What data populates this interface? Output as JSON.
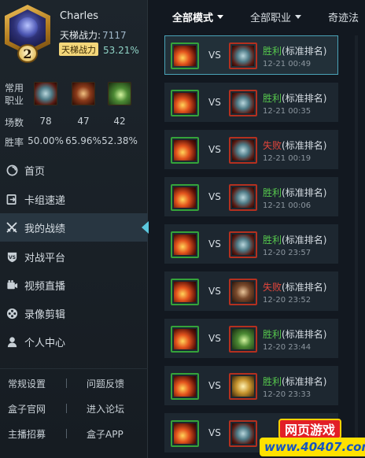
{
  "profile": {
    "name": "Charles",
    "level": "2",
    "rank_power_label": "天梯战力:",
    "rank_power_value": "7117",
    "rank_tag": "天梯战力",
    "rank_pct": "53.21%"
  },
  "stats": {
    "class_label": "常用职业",
    "class_icons": [
      "mech-class-icon",
      "beast-class-icon",
      "nature-class-icon"
    ],
    "games_label": "场数",
    "games": [
      "78",
      "47",
      "42"
    ],
    "winrate_label": "胜率",
    "winrates": [
      "50.00%",
      "65.96%",
      "52.38%"
    ]
  },
  "nav": {
    "items": [
      {
        "label": "首页",
        "icon": "home-icon"
      },
      {
        "label": "卡组速递",
        "icon": "deck-icon"
      },
      {
        "label": "我的战绩",
        "icon": "swords-icon"
      },
      {
        "label": "对战平台",
        "icon": "vs-icon"
      },
      {
        "label": "视频直播",
        "icon": "video-icon"
      },
      {
        "label": "录像剪辑",
        "icon": "film-icon"
      },
      {
        "label": "个人中心",
        "icon": "user-icon"
      }
    ],
    "active_index": 2
  },
  "bottom_links": [
    "常规设置",
    "问题反馈",
    "盒子官网",
    "进入论坛",
    "主播招募",
    "盒子APP"
  ],
  "filters": {
    "mode": "全部模式",
    "class": "全部职业",
    "third": "奇迹法"
  },
  "matches": [
    {
      "vs": "VS",
      "result": "胜利",
      "outcome": "win",
      "mode": "(标准排名)",
      "time": "12-21 00:49",
      "opp_art": "art-mech"
    },
    {
      "vs": "VS",
      "result": "胜利",
      "outcome": "win",
      "mode": "(标准排名)",
      "time": "12-21 00:35",
      "opp_art": "art-mech"
    },
    {
      "vs": "VS",
      "result": "失败",
      "outcome": "lose",
      "mode": "(标准排名)",
      "time": "12-21 00:19",
      "opp_art": "art-mech"
    },
    {
      "vs": "VS",
      "result": "胜利",
      "outcome": "win",
      "mode": "(标准排名)",
      "time": "12-21 00:06",
      "opp_art": "art-mech"
    },
    {
      "vs": "VS",
      "result": "胜利",
      "outcome": "win",
      "mode": "(标准排名)",
      "time": "12-20 23:57",
      "opp_art": "art-mech"
    },
    {
      "vs": "VS",
      "result": "失败",
      "outcome": "lose",
      "mode": "(标准排名)",
      "time": "12-20 23:52",
      "opp_art": "art-beast"
    },
    {
      "vs": "VS",
      "result": "胜利",
      "outcome": "win",
      "mode": "(标准排名)",
      "time": "12-20 23:44",
      "opp_art": "art-green"
    },
    {
      "vs": "VS",
      "result": "胜利",
      "outcome": "win",
      "mode": "(标准排名)",
      "time": "12-20 23:33",
      "opp_art": "art-gold"
    },
    {
      "vs": "VS",
      "result": "",
      "outcome": "win",
      "mode": "",
      "time": "",
      "opp_art": "art-mech"
    }
  ],
  "watermark": {
    "top": "网页游戏",
    "bottom": "www.40407.com"
  },
  "colors": {
    "win": "#56c84d",
    "lose": "#e5463c",
    "accent": "#4aa3b8"
  }
}
